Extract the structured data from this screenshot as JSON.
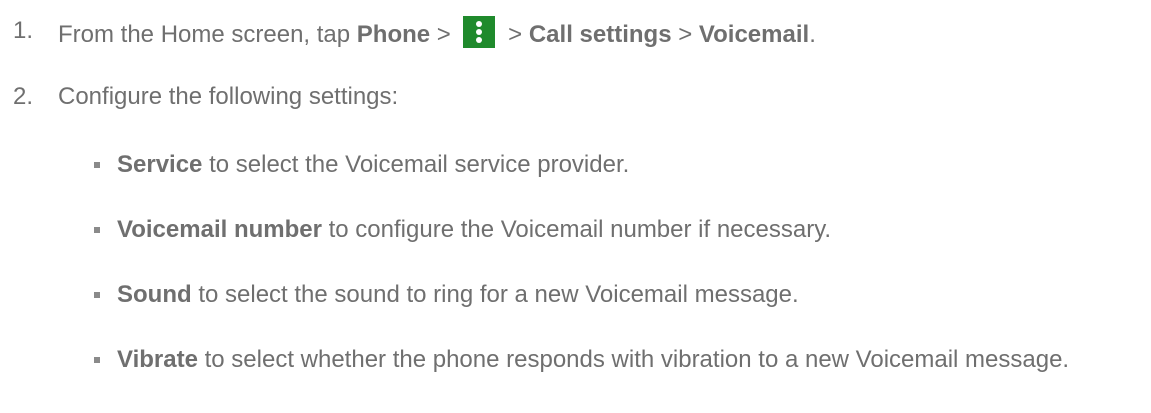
{
  "steps": [
    {
      "number": "1.",
      "prefix": "From the Home screen, tap ",
      "phone": "Phone",
      "sep1": " > ",
      "sep2": " > ",
      "call_settings": "Call settings",
      "sep3": " > ",
      "voicemail": "Voicemail",
      "end": ".",
      "icon": "more-vert-icon",
      "icon_color": "#1f8a2c"
    },
    {
      "number": "2.",
      "text": "Configure the following settings:"
    }
  ],
  "settings": [
    {
      "term": "Service",
      "desc": " to select the Voicemail service provider."
    },
    {
      "term": "Voicemail number",
      "desc": " to configure the Voicemail number if necessary."
    },
    {
      "term": "Sound",
      "desc": " to select the sound to ring for a new Voicemail message."
    },
    {
      "term": "Vibrate",
      "desc": " to select whether the phone responds with vibration to a new Voicemail message."
    }
  ],
  "colors": {
    "text": "#6f6f6f",
    "accent": "#1f8a2c"
  }
}
